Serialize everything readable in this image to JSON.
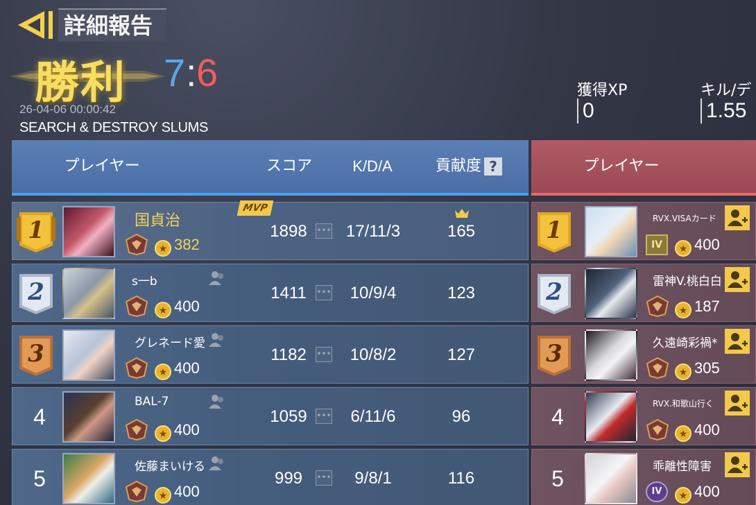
{
  "header": {
    "title": "詳細報告",
    "result": "勝利",
    "score_blue": "7",
    "score_sep": ":",
    "score_red": "6",
    "datetime": "26-04-06 00:00:42",
    "mode": "SEARCH & DESTROY   SLUMS"
  },
  "stats": {
    "xp_label": "獲得XP",
    "xp_value": "0",
    "kd_label": "キル/デ",
    "kd_value": "1.55"
  },
  "columns": {
    "player": "プレイヤー",
    "score": "スコア",
    "kda": "K/D/A",
    "contribution": "貢献度",
    "help": "?",
    "player_red": "プレイヤー"
  },
  "mvp_label": "MVP",
  "blue_team": [
    {
      "rank": "1",
      "name": "国貞治",
      "level": "382",
      "score": "1898",
      "kda": "17/11/3",
      "contribution": "165"
    },
    {
      "rank": "2",
      "name": "s一b",
      "level": "400",
      "score": "1411",
      "kda": "10/9/4",
      "contribution": "123"
    },
    {
      "rank": "3",
      "name": "グレネード愛",
      "level": "400",
      "score": "1182",
      "kda": "10/8/2",
      "contribution": "127"
    },
    {
      "rank": "4",
      "name": "BAL-7",
      "level": "400",
      "score": "1059",
      "kda": "6/11/6",
      "contribution": "96"
    },
    {
      "rank": "5",
      "name": "佐藤まいける",
      "level": "400",
      "score": "999",
      "kda": "9/8/1",
      "contribution": "116"
    }
  ],
  "red_team": [
    {
      "rank": "1",
      "name": "RVX.VISAカード",
      "level": "400",
      "emblem": "IV"
    },
    {
      "rank": "2",
      "name": "雷神V.桃白白",
      "level": "187"
    },
    {
      "rank": "3",
      "name": "久遠崎彩禍*",
      "level": "305"
    },
    {
      "rank": "4",
      "name": "RVX.和歌山行く",
      "level": "400"
    },
    {
      "rank": "5",
      "name": "乖離性障害",
      "level": "400",
      "emblem": "IV"
    }
  ],
  "colors": {
    "blue_accent": "#4aa1f0",
    "red_accent": "#e96a6a",
    "gold": "#f5d25a",
    "victory": "#f7de63"
  },
  "icons": [
    "back-arrow-icon",
    "dots-icon",
    "crown-icon",
    "friend-icon",
    "add-friend-icon",
    "star-icon",
    "rank-emblem-icon"
  ]
}
